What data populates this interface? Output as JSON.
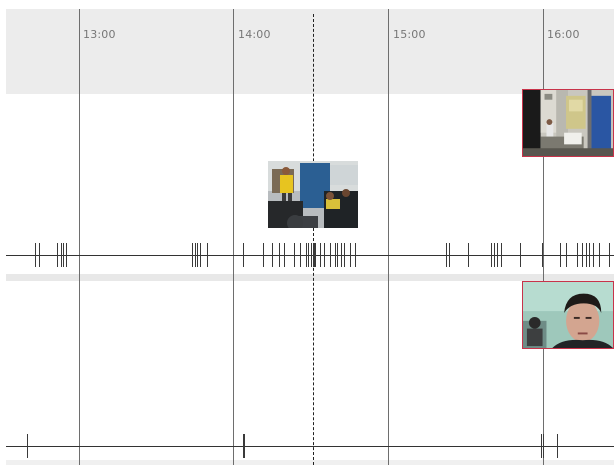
{
  "timeline": {
    "time_labels": [
      "13:00",
      "14:00",
      "15:00",
      "16:00"
    ]
  },
  "colors": {
    "header_background": "#ececec",
    "thumbnail_highlight_border": "#c8334a",
    "axis_line": "#333333"
  },
  "tracks": [
    {
      "name": "track-1",
      "thumbnails": [
        {
          "name": "thumbnail-classroom-presentation",
          "content": "photo",
          "highlighted": false
        },
        {
          "name": "thumbnail-office-room",
          "content": "photo",
          "highlighted": true
        }
      ]
    },
    {
      "name": "track-2",
      "thumbnails": [
        {
          "name": "thumbnail-webcam-face",
          "content": "photo",
          "highlighted": true
        }
      ]
    }
  ]
}
